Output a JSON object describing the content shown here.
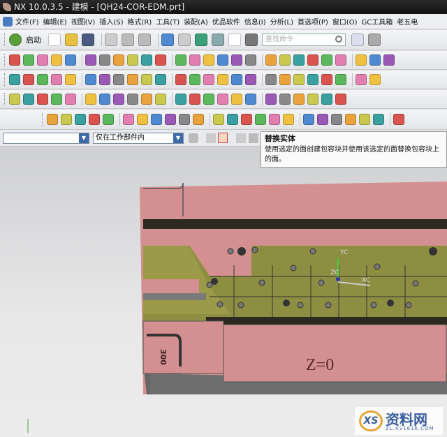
{
  "window": {
    "title": "NX 10.0.3.5 - 建模 - [QH24-COR-EDM.prt]"
  },
  "menu": [
    "文件(F)",
    "编辑(E)",
    "视图(V)",
    "插入(S)",
    "格式(R)",
    "工具(T)",
    "装配(A)",
    "优品软件",
    "信息(I)",
    "分析(L)",
    "首选项(P)",
    "窗口(O)",
    "GC工具箱",
    "老五电"
  ],
  "toolbar": {
    "start_label": "启动",
    "search_placeholder": "查找命令"
  },
  "selection": {
    "filter_value": "",
    "scope_value": "仅在工作部件内"
  },
  "tooltip": {
    "title": "替换实体",
    "body": "使用选定的面创建包容块并使用该选定的面替换包容块上的面。"
  },
  "model": {
    "label_z": "Z=0",
    "label_300": "300",
    "axis_x": "XC",
    "axis_y": "YC",
    "axis_z": "ZC"
  },
  "watermark": {
    "text": "资料网",
    "url": "ZL.XS1616.COM",
    "logo": "XS"
  },
  "icon_colors": [
    "#d9534f",
    "#e8a33c",
    "#4f8ad1",
    "#5cb85c",
    "#c9c94f",
    "#9b59b6",
    "#e07fb0",
    "#3aa0a0",
    "#888888",
    "#f0c040"
  ]
}
